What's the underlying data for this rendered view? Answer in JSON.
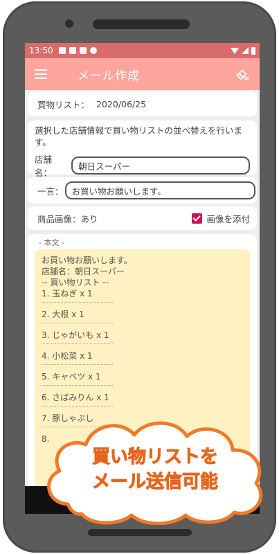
{
  "status": {
    "time": "13:50"
  },
  "appbar": {
    "title": "メール作成"
  },
  "list_row": {
    "label": "買物リスト：",
    "date": "2020/06/25"
  },
  "store": {
    "description": "選択した店舗情報で買い物リストの並べ替えを行います。",
    "label": "店舗名：",
    "value": "朝日スーパー"
  },
  "comment": {
    "label": "一言：",
    "value": "お買い物お願いします。"
  },
  "image": {
    "label": "商品画像：あり",
    "attach_label": "画像を添付",
    "attach_checked": true
  },
  "body": {
    "legend": "- 本文 -",
    "greeting": "お買い物お願いします。",
    "store_line": "店舗名：朝日スーパー",
    "list_header": "-- 買い物リスト --",
    "items": [
      "1. 玉ねぎ x 1",
      "2. 大根 x 1",
      "3. じゃがいも x 1",
      "4. 小松菜 x 1",
      "5. キャベツ x 1",
      "6. さばみりん x 1",
      "7. 豚しゃぶし",
      "8."
    ]
  },
  "callout": {
    "line1": "買い物リストを",
    "line2": "メール送信可能"
  },
  "colors": {
    "statusbar": "#d86b6b",
    "appbar": "#fba59c",
    "mailbox": "#fff1c1",
    "checkbox": "#c2185b",
    "callout_text": "#e6661d"
  }
}
